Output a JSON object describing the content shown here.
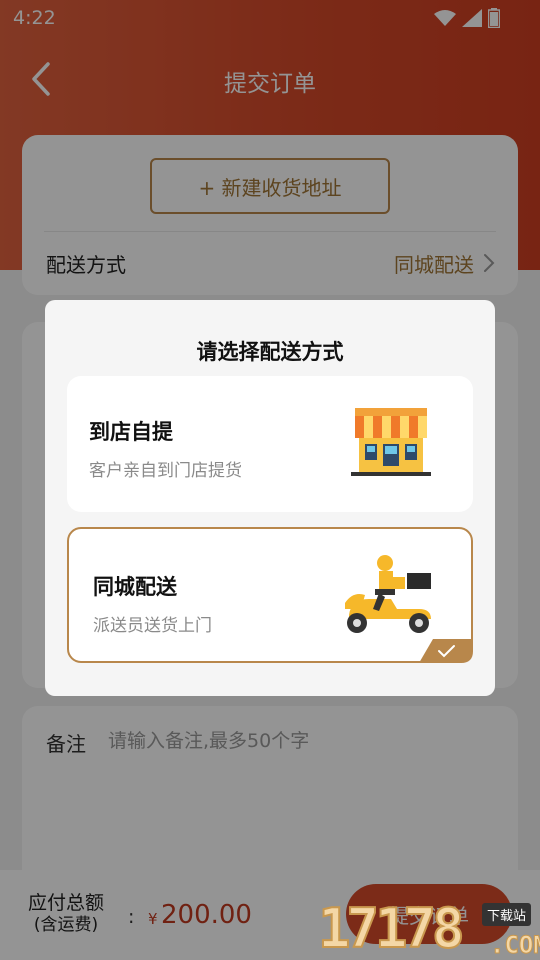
{
  "status_bar": {
    "time": "4:22",
    "icons": [
      "wifi-icon",
      "signal-icon",
      "battery-icon"
    ]
  },
  "navbar": {
    "title": "提交订单",
    "back_icon": "chevron-left-icon"
  },
  "address_card": {
    "new_address_button": "+ 新建收货地址",
    "shipping_label": "配送方式",
    "shipping_value": "同城配送"
  },
  "remark": {
    "label": "备注",
    "placeholder": "请输入备注,最多50个字",
    "value": ""
  },
  "bottom_bar": {
    "total_label": "应付总额",
    "total_sublabel": "(含运费)",
    "colon": ":",
    "currency": "¥",
    "amount": "200.00",
    "submit_label": "提交订单"
  },
  "modal": {
    "title": "请选择配送方式",
    "options": [
      {
        "title": "到店自提",
        "desc": "客户亲自到门店提货",
        "icon": "store-icon",
        "selected": false
      },
      {
        "title": "同城配送",
        "desc": "派送员送货上门",
        "icon": "delivery-scooter-icon",
        "selected": true
      }
    ],
    "check_icon": "checkmark-icon"
  },
  "watermark": {
    "digits": "17178",
    "tag": "下载站",
    "suffix": ".COM"
  },
  "colors": {
    "header_red": "#d64a2a",
    "gold_accent": "#b8874b",
    "price_red": "#c23a1f"
  }
}
